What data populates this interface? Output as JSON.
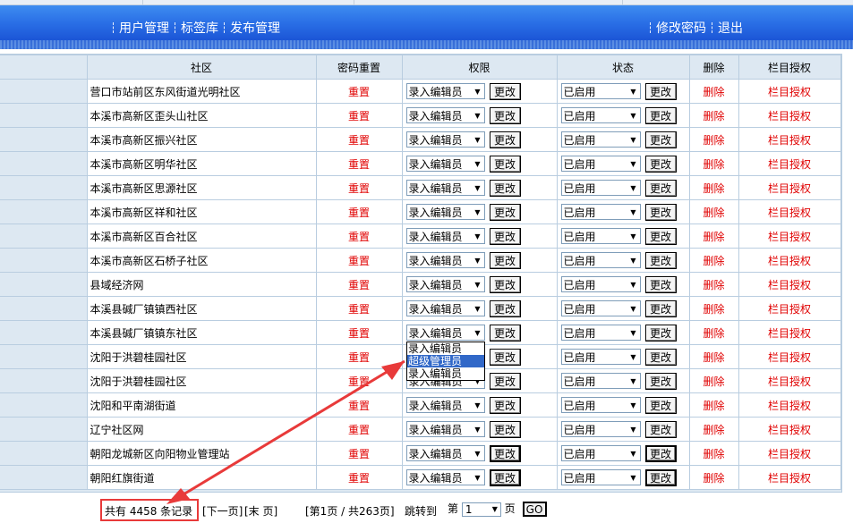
{
  "header": {
    "nav_left": [
      "用户管理",
      "标签库",
      "发布管理"
    ],
    "nav_right": [
      "修改密码",
      "退出"
    ]
  },
  "table": {
    "columns": [
      "社区",
      "密码重置",
      "权限",
      "状态",
      "删除",
      "栏目授权"
    ],
    "reset_label": "重置",
    "change_label": "更改",
    "delete_label": "删除",
    "auth_label": "栏目授权",
    "role_value": "录入编辑员",
    "status_value": "已启用",
    "rows": [
      "营口市站前区东风街道光明社区",
      "本溪市高新区歪头山社区",
      "本溪市高新区振兴社区",
      "本溪市高新区明华社区",
      "本溪市高新区思源社区",
      "本溪市高新区祥和社区",
      "本溪市高新区百合社区",
      "本溪市高新区石桥子社区",
      "县域经济网",
      "本溪县碱厂镇镇西社区",
      "本溪县碱厂镇镇东社区",
      "沈阳于洪碧桂园社区",
      "沈阳于洪碧桂园社区",
      "沈阳和平南湖街道",
      "辽宁社区网",
      "朝阳龙城新区向阳物业管理站",
      "朝阳红旗街道"
    ]
  },
  "dropdown": {
    "options": [
      "录入编辑员",
      "超级管理员",
      "录入编辑员"
    ],
    "highlighted": 1
  },
  "footer": {
    "total": "共有 4458 条记录",
    "next": "[下一页]",
    "last": "[末 页]",
    "page_info": "[第1页 / 共263页]",
    "jump_label": "跳转到",
    "page_prefix": "第",
    "page_value": "1",
    "page_suffix": "页",
    "go_label": "GO"
  },
  "colors": {
    "header_blue": "#1b55d6",
    "link_red": "#e00000",
    "annotation_red": "#e83a3a",
    "panel_bg": "#dde8f2"
  }
}
